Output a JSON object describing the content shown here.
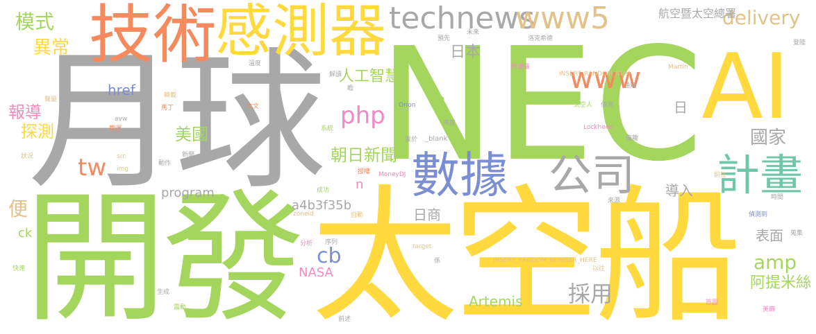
{
  "palette": {
    "green": "#A4D65E",
    "yellow": "#FFD93D",
    "gray": "#A8A8A8",
    "orange": "#F58A5E",
    "blue": "#7B8ED4",
    "pink": "#F08AC0",
    "teal": "#6FC7A5",
    "tan": "#E3C28A"
  },
  "words": {
    "nec": "NEC",
    "moon": "月球",
    "develop": "開發",
    "spacecraft": "太空船",
    "ai": "AI",
    "technology": "技術",
    "sensor": "感測器",
    "technews": "technews",
    "www5": "www5",
    "data": "數據",
    "company": "公司",
    "plan": "計畫",
    "www": "www",
    "php": "php",
    "tw": "tw",
    "mode": "模式",
    "abnormal": "異常",
    "report": "報導",
    "detect": "探測",
    "href": "href",
    "usa": "美國",
    "asahi": "朝日新聞",
    "ai_jp": "人工智慧",
    "japan": "日本",
    "delivery": "delivery",
    "jaxa": "航空暨太空總署",
    "day": "日",
    "country": "國家",
    "amp": "amp",
    "adopt": "採用",
    "artemis_zh": "阿提米絲",
    "artemis": "Artemis",
    "cb": "cb",
    "nasa": "NASA",
    "program": "program",
    "hash": "a4b3f35b",
    "jp_firm": "日商",
    "surface": "表面",
    "import": "導入",
    "convenient": "便",
    "ck": "ck",
    "a": "a",
    "n": "n",
    "blank": "_blank",
    "zoneid": "zoneid",
    "target": "target",
    "moneydj": "MoneyDJ",
    "lockheed": "Lockheed",
    "martin": "Martin",
    "orion": "Orion",
    "rand_num": "INSERT_RANDOM_NUM",
    "rand_num_here": "INSERT_RANDOM_NUMBER_HERE",
    "avw": "avw",
    "src": "src",
    "img": "img",
    "preset": "預先",
    "future": "未來",
    "lockheed_zh": "洛克希德",
    "land": "登陸",
    "temperature": "溫度",
    "apollo": "阿波羅",
    "decode": "解讀",
    "text": "本文",
    "notify": "通知",
    "astronaut": "太空人",
    "interpret": "偵測",
    "reset": "再度",
    "deviate": "偏離",
    "system": "系統",
    "differ": "異於",
    "payload": "載運",
    "martin_zh": "馬丁",
    "transfer": "轉載",
    "news": "新聞",
    "action": "動作",
    "status": "狀況",
    "volume": "聲量",
    "success": "成功",
    "authorize": "授權",
    "auto": "自動",
    "sequence": "序列",
    "analysis": "分析",
    "related": "係",
    "fast": "快速",
    "generate": "生成",
    "vibrate": "震動",
    "forward": "前述",
    "origin": "來源",
    "time": "時間",
    "go_to": "前往",
    "detected": "偵測到",
    "gather": "蒐集",
    "past": "以往",
    "front_page": "首圖",
    "us_firm": "美商",
    "zhan": "瞻"
  }
}
